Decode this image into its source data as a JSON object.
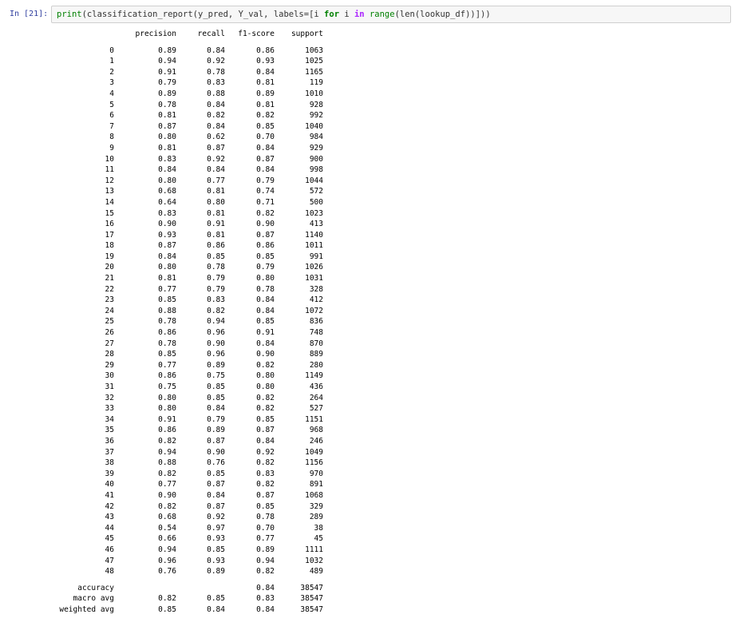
{
  "cell": {
    "prompt": "In [21]:",
    "code": {
      "fn1": "print",
      "p1": "(classification_report(y_pred, Y_val, labels=[i ",
      "kw_for": "for",
      "p2": " i ",
      "kw_in": "in",
      "p3": " ",
      "fn2": "range",
      "p4": "(len(lookup_df))]))"
    }
  },
  "report": {
    "headers": [
      "",
      "precision",
      "recall",
      "f1-score",
      "support"
    ],
    "rows": [
      [
        "0",
        "0.89",
        "0.84",
        "0.86",
        "1063"
      ],
      [
        "1",
        "0.94",
        "0.92",
        "0.93",
        "1025"
      ],
      [
        "2",
        "0.91",
        "0.78",
        "0.84",
        "1165"
      ],
      [
        "3",
        "0.79",
        "0.83",
        "0.81",
        "119"
      ],
      [
        "4",
        "0.89",
        "0.88",
        "0.89",
        "1010"
      ],
      [
        "5",
        "0.78",
        "0.84",
        "0.81",
        "928"
      ],
      [
        "6",
        "0.81",
        "0.82",
        "0.82",
        "992"
      ],
      [
        "7",
        "0.87",
        "0.84",
        "0.85",
        "1040"
      ],
      [
        "8",
        "0.80",
        "0.62",
        "0.70",
        "984"
      ],
      [
        "9",
        "0.81",
        "0.87",
        "0.84",
        "929"
      ],
      [
        "10",
        "0.83",
        "0.92",
        "0.87",
        "900"
      ],
      [
        "11",
        "0.84",
        "0.84",
        "0.84",
        "998"
      ],
      [
        "12",
        "0.80",
        "0.77",
        "0.79",
        "1044"
      ],
      [
        "13",
        "0.68",
        "0.81",
        "0.74",
        "572"
      ],
      [
        "14",
        "0.64",
        "0.80",
        "0.71",
        "500"
      ],
      [
        "15",
        "0.83",
        "0.81",
        "0.82",
        "1023"
      ],
      [
        "16",
        "0.90",
        "0.91",
        "0.90",
        "413"
      ],
      [
        "17",
        "0.93",
        "0.81",
        "0.87",
        "1140"
      ],
      [
        "18",
        "0.87",
        "0.86",
        "0.86",
        "1011"
      ],
      [
        "19",
        "0.84",
        "0.85",
        "0.85",
        "991"
      ],
      [
        "20",
        "0.80",
        "0.78",
        "0.79",
        "1026"
      ],
      [
        "21",
        "0.81",
        "0.79",
        "0.80",
        "1031"
      ],
      [
        "22",
        "0.77",
        "0.79",
        "0.78",
        "328"
      ],
      [
        "23",
        "0.85",
        "0.83",
        "0.84",
        "412"
      ],
      [
        "24",
        "0.88",
        "0.82",
        "0.84",
        "1072"
      ],
      [
        "25",
        "0.78",
        "0.94",
        "0.85",
        "836"
      ],
      [
        "26",
        "0.86",
        "0.96",
        "0.91",
        "748"
      ],
      [
        "27",
        "0.78",
        "0.90",
        "0.84",
        "870"
      ],
      [
        "28",
        "0.85",
        "0.96",
        "0.90",
        "889"
      ],
      [
        "29",
        "0.77",
        "0.89",
        "0.82",
        "280"
      ],
      [
        "30",
        "0.86",
        "0.75",
        "0.80",
        "1149"
      ],
      [
        "31",
        "0.75",
        "0.85",
        "0.80",
        "436"
      ],
      [
        "32",
        "0.80",
        "0.85",
        "0.82",
        "264"
      ],
      [
        "33",
        "0.80",
        "0.84",
        "0.82",
        "527"
      ],
      [
        "34",
        "0.91",
        "0.79",
        "0.85",
        "1151"
      ],
      [
        "35",
        "0.86",
        "0.89",
        "0.87",
        "968"
      ],
      [
        "36",
        "0.82",
        "0.87",
        "0.84",
        "246"
      ],
      [
        "37",
        "0.94",
        "0.90",
        "0.92",
        "1049"
      ],
      [
        "38",
        "0.88",
        "0.76",
        "0.82",
        "1156"
      ],
      [
        "39",
        "0.82",
        "0.85",
        "0.83",
        "970"
      ],
      [
        "40",
        "0.77",
        "0.87",
        "0.82",
        "891"
      ],
      [
        "41",
        "0.90",
        "0.84",
        "0.87",
        "1068"
      ],
      [
        "42",
        "0.82",
        "0.87",
        "0.85",
        "329"
      ],
      [
        "43",
        "0.68",
        "0.92",
        "0.78",
        "289"
      ],
      [
        "44",
        "0.54",
        "0.97",
        "0.70",
        "38"
      ],
      [
        "45",
        "0.66",
        "0.93",
        "0.77",
        "45"
      ],
      [
        "46",
        "0.94",
        "0.85",
        "0.89",
        "1111"
      ],
      [
        "47",
        "0.96",
        "0.93",
        "0.94",
        "1032"
      ],
      [
        "48",
        "0.76",
        "0.89",
        "0.82",
        "489"
      ]
    ],
    "summary": [
      [
        "accuracy",
        "",
        "",
        "0.84",
        "38547"
      ],
      [
        "macro avg",
        "0.82",
        "0.85",
        "0.83",
        "38547"
      ],
      [
        "weighted avg",
        "0.85",
        "0.84",
        "0.84",
        "38547"
      ]
    ]
  }
}
